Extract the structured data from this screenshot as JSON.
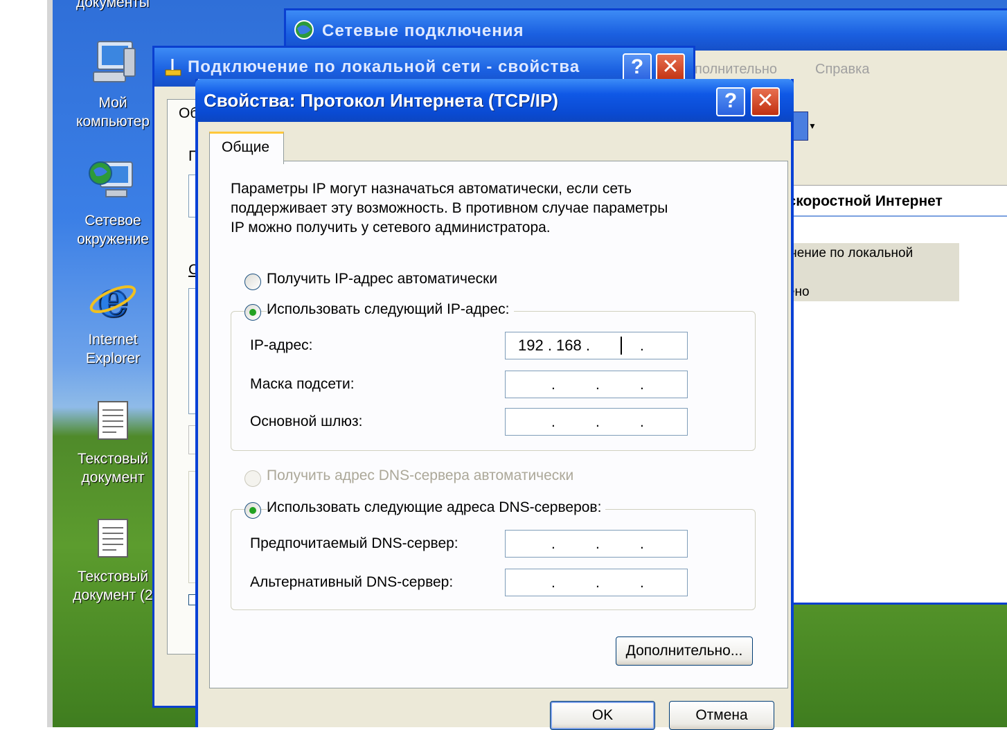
{
  "desktop": {
    "partial_top_label": "документы",
    "icons": [
      {
        "label_line1": "Мой",
        "label_line2": "компьютер",
        "icon": "my-computer-icon"
      },
      {
        "label_line1": "Сетевое",
        "label_line2": "окружение",
        "icon": "network-places-icon"
      },
      {
        "label_line1": "Internet",
        "label_line2": "Explorer",
        "icon": "internet-explorer-icon"
      },
      {
        "label_line1": "Текстовый",
        "label_line2": "документ",
        "icon": "text-document-icon"
      },
      {
        "label_line1": "Текстовый",
        "label_line2": "документ (2",
        "icon": "text-document-icon"
      }
    ]
  },
  "bg_window": {
    "title": "Сетевые подключения",
    "menu": [
      "полнительно",
      "Справка"
    ],
    "group_header": "оскоростной Интернет",
    "connection_line1": "ючение по локальной",
    "connection_line2": "чено"
  },
  "mid_window": {
    "title": "Подключение по локальной сети - свойства",
    "tab_fragment": "Об",
    "frag1": "П",
    "frag2": "С"
  },
  "dialog": {
    "title": "Свойства: Протокол Интернета (TCP/IP)",
    "help_label": "?",
    "close_label": "✕",
    "tab": "Общие",
    "description": [
      "Параметры IP могут назначаться автоматически, если сеть",
      "поддерживает эту возможность. В противном случае параметры",
      "IP можно получить у сетевого администратора."
    ],
    "ip_auto": "Получить IP-адрес автоматически",
    "ip_manual": "Использовать следующий IP-адрес:",
    "ip_address_label": "IP-адрес:",
    "ip_address_value": "192 . 168 .",
    "subnet_label": "Маска подсети:",
    "gateway_label": "Основной шлюз:",
    "dns_auto": "Получить адрес DNS-сервера автоматически",
    "dns_manual": "Использовать следующие адреса DNS-серверов:",
    "dns_preferred_label": "Предпочитаемый DNS-сервер:",
    "dns_alternate_label": "Альтернативный DNS-сервер:",
    "advanced_button": "Дополнительно...",
    "ok_button": "OK",
    "cancel_button": "Отмена"
  },
  "colors": {
    "title_blue": "#0a4ad2",
    "dialog_bg": "#ece9d8",
    "radio_green": "#21a121"
  }
}
